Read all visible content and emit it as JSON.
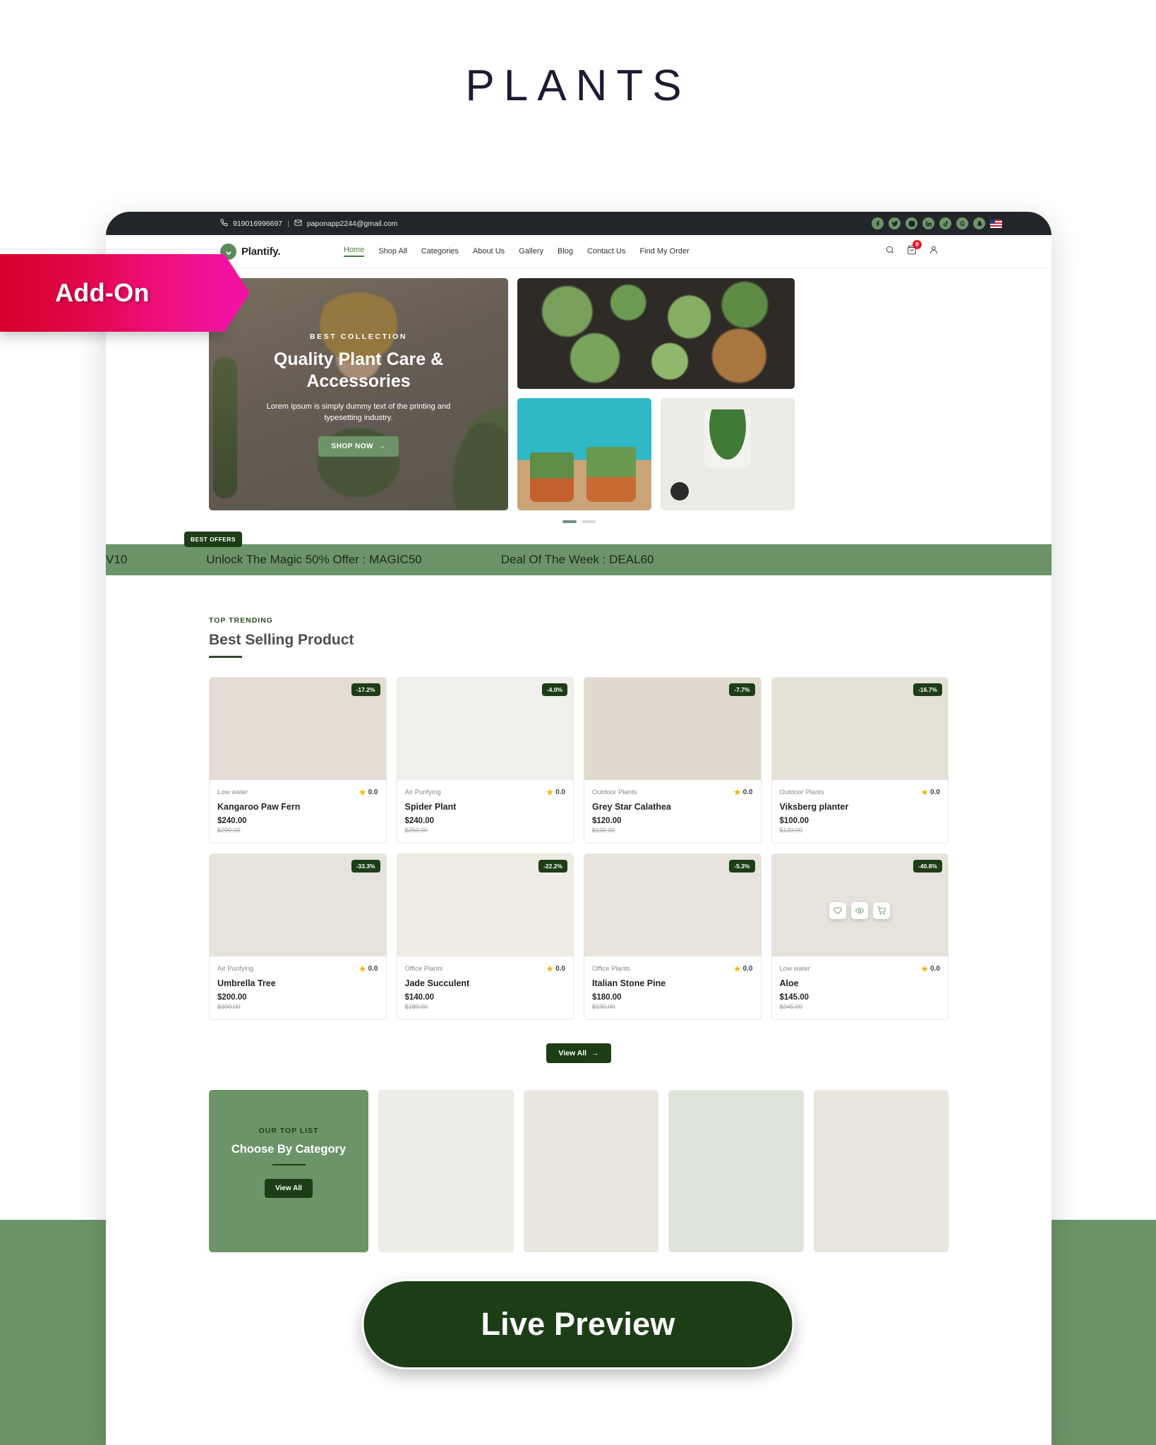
{
  "page": {
    "title": "PLANTS",
    "addon_ribbon": "Add-On",
    "live_preview": "Live Preview"
  },
  "topbar": {
    "phone": "919016996697",
    "separator": "|",
    "email": "paponapp2244@gmail.com",
    "socials": [
      "facebook-icon",
      "twitter-icon",
      "instagram-icon",
      "linkedin-icon",
      "tiktok-icon",
      "google-icon",
      "snapchat-icon"
    ],
    "flag": "us-flag-icon"
  },
  "nav": {
    "brand": "Plantify.",
    "links": [
      {
        "label": "Home",
        "active": true
      },
      {
        "label": "Shop All",
        "active": false
      },
      {
        "label": "Categories",
        "active": false
      },
      {
        "label": "About Us",
        "active": false
      },
      {
        "label": "Gallery",
        "active": false
      },
      {
        "label": "Blog",
        "active": false
      },
      {
        "label": "Contact Us",
        "active": false
      },
      {
        "label": "Find My Order",
        "active": false
      }
    ],
    "cart_count": "0"
  },
  "hero": {
    "eyebrow": "BEST COLLECTION",
    "heading": "Quality Plant Care & Accessories",
    "subtext": "Lorem Ipsum is simply dummy text of the printing and typesetting industry.",
    "cta": "SHOP NOW",
    "cta_arrow": "→"
  },
  "offers": {
    "badge": "BEST OFFERS",
    "items": [
      "V10",
      "Unlock The Magic 50% Offer : MAGIC50",
      "Deal Of The Week : DEAL60"
    ]
  },
  "best_selling": {
    "eyebrow": "TOP TRENDING",
    "title": "Best Selling Product",
    "view_all": "View All",
    "view_all_arrow": "→",
    "products": [
      {
        "discount": "-17.2%",
        "category": "Low water",
        "rating": "0.0",
        "name": "Kangaroo Paw Fern",
        "price": "$240.00",
        "old_price": "$290.00"
      },
      {
        "discount": "-4.0%",
        "category": "Air Purifying",
        "rating": "0.0",
        "name": "Spider Plant",
        "price": "$240.00",
        "old_price": "$250.00"
      },
      {
        "discount": "-7.7%",
        "category": "Outdoor Plants",
        "rating": "0.0",
        "name": "Grey Star Calathea",
        "price": "$120.00",
        "old_price": "$130.00"
      },
      {
        "discount": "-16.7%",
        "category": "Outdoor Plants",
        "rating": "0.0",
        "name": "Viksberg planter",
        "price": "$100.00",
        "old_price": "$120.00"
      },
      {
        "discount": "-33.3%",
        "category": "Air Purifying",
        "rating": "0.0",
        "name": "Umbrella Tree",
        "price": "$200.00",
        "old_price": "$300.00"
      },
      {
        "discount": "-22.2%",
        "category": "Office Plants",
        "rating": "0.0",
        "name": "Jade Succulent",
        "price": "$140.00",
        "old_price": "$180.00"
      },
      {
        "discount": "-5.3%",
        "category": "Office Plants",
        "rating": "0.0",
        "name": "Italian Stone Pine",
        "price": "$180.00",
        "old_price": "$190.00"
      },
      {
        "discount": "-40.8%",
        "category": "Low water",
        "rating": "0.0",
        "name": "Aloe",
        "price": "$145.00",
        "old_price": "$245.00"
      }
    ],
    "hover_actions": [
      "wishlist-heart-icon",
      "quick-view-eye-icon",
      "add-to-cart-icon"
    ]
  },
  "category_section": {
    "eyebrow": "OUR TOP LIST",
    "title": "Choose By Category",
    "button": "View All"
  }
}
